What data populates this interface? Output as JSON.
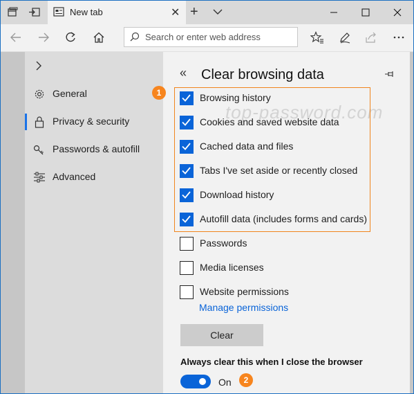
{
  "titlebar": {
    "tab_title": "New tab",
    "tab_close": "✕",
    "new_tab": "+"
  },
  "navbar": {
    "address_placeholder": "Search or enter web address"
  },
  "settings_nav": {
    "items": [
      {
        "label": "General",
        "icon": "gear-icon"
      },
      {
        "label": "Privacy & security",
        "icon": "lock-icon",
        "selected": true
      },
      {
        "label": "Passwords & autofill",
        "icon": "key-icon"
      },
      {
        "label": "Advanced",
        "icon": "sliders-icon"
      }
    ]
  },
  "panel": {
    "back": "«",
    "title": "Clear browsing data",
    "watermark": "top-password.com",
    "checkboxes": [
      {
        "label": "Browsing history",
        "checked": true
      },
      {
        "label": "Cookies and saved website data",
        "checked": true
      },
      {
        "label": "Cached data and files",
        "checked": true
      },
      {
        "label": "Tabs I've set aside or recently closed",
        "checked": true
      },
      {
        "label": "Download history",
        "checked": true
      },
      {
        "label": "Autofill data (includes forms and cards)",
        "checked": true
      },
      {
        "label": "Passwords",
        "checked": false
      },
      {
        "label": "Media licenses",
        "checked": false
      },
      {
        "label": "Website permissions",
        "checked": false
      }
    ],
    "manage_permissions": "Manage permissions",
    "clear_button": "Clear",
    "always_clear_label": "Always clear this when I close the browser",
    "toggle_state": "On"
  },
  "annotations": {
    "badge1": "1",
    "badge2": "2",
    "color": "#f7851e"
  },
  "colors": {
    "accent": "#0a64d8"
  }
}
